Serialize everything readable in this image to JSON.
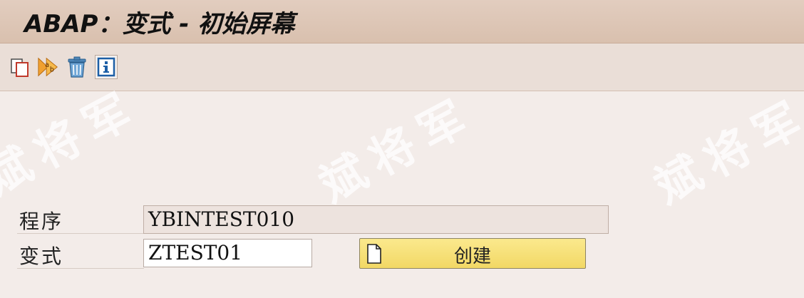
{
  "window": {
    "title": "ABAP：变式 - 初始屏幕"
  },
  "toolbar": {
    "items": [
      {
        "name": "copy",
        "icon": "copy-icon"
      },
      {
        "name": "rename",
        "icon": "rename-icon"
      },
      {
        "name": "delete",
        "icon": "trash-icon"
      },
      {
        "name": "info",
        "icon": "info-icon"
      }
    ]
  },
  "watermark": {
    "text": "斌将军"
  },
  "form": {
    "program_label": "程序",
    "program_value": "YBINTEST010",
    "variant_label": "变式",
    "variant_value": "ZTEST01"
  },
  "buttons": {
    "create_label": "创建"
  },
  "colors": {
    "title_bar": "#dcc5b4",
    "toolbar": "#eaded7",
    "background": "#f3ece9",
    "button": "#f6df72"
  }
}
